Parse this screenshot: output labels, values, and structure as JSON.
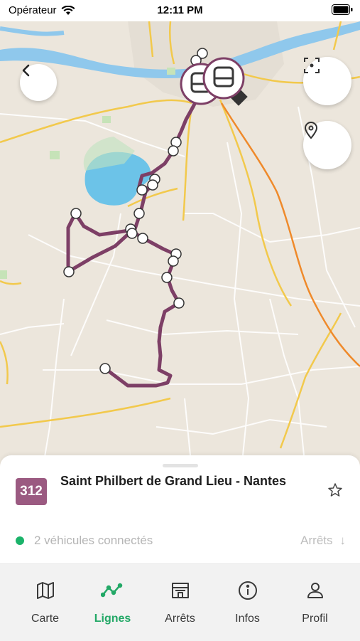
{
  "status": {
    "carrier": "Opérateur",
    "time": "12:11 PM"
  },
  "map": {
    "route_color": "#7d3f66"
  },
  "line": {
    "number": "312",
    "badge_color": "#9b5a81",
    "title": "Saint Philbert de Grand Lieu - Nantes",
    "vehicles_text": "2 véhicules connectés",
    "stops_link": "Arrêts",
    "stops_arrow": "↓"
  },
  "tabs": [
    {
      "label": "Carte",
      "icon": "map-icon"
    },
    {
      "label": "Lignes",
      "icon": "lines-icon",
      "active": true
    },
    {
      "label": "Arrêts",
      "icon": "stop-icon"
    },
    {
      "label": "Infos",
      "icon": "info-icon"
    },
    {
      "label": "Profil",
      "icon": "profile-icon"
    }
  ],
  "colors": {
    "accent": "#22a866",
    "status_dot": "#1bb36a"
  }
}
